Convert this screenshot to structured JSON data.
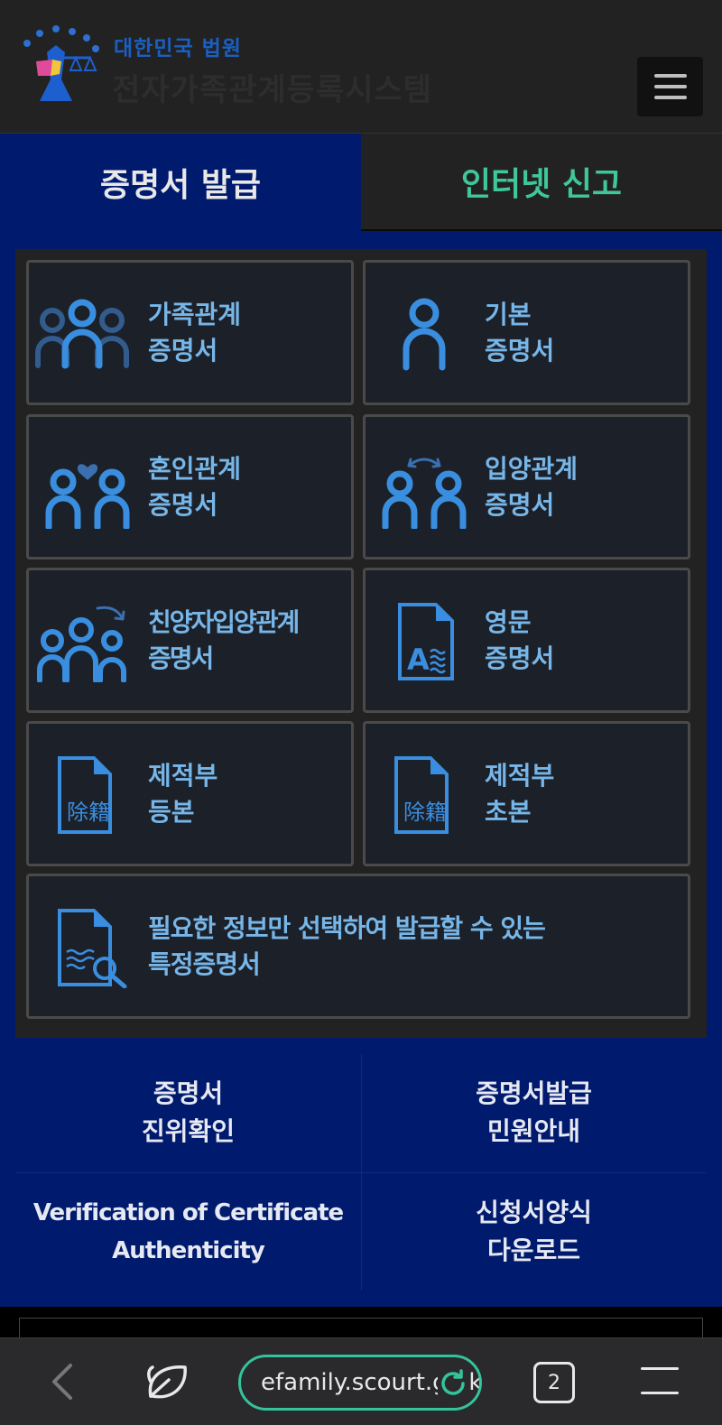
{
  "header": {
    "org": "대한민국 법원",
    "system": "전자가족관계등록시스템"
  },
  "tabs": [
    {
      "label": "증명서 발급",
      "active": true
    },
    {
      "label": "인터넷 신고",
      "active": false
    }
  ],
  "cards": [
    {
      "line1": "가족관계",
      "line2": "증명서",
      "icon": "family-icon"
    },
    {
      "line1": "기본",
      "line2": "증명서",
      "icon": "person-icon"
    },
    {
      "line1": "혼인관계",
      "line2": "증명서",
      "icon": "couple-heart-icon"
    },
    {
      "line1": "입양관계",
      "line2": "증명서",
      "icon": "adoption-icon"
    },
    {
      "line1": "친양자입양관계",
      "line2": "증명서",
      "icon": "family-adoption-icon"
    },
    {
      "line1": "영문",
      "line2": "증명서",
      "icon": "english-document-icon"
    },
    {
      "line1": "제적부",
      "line2": "등본",
      "icon": "removed-register-document-icon"
    },
    {
      "line1": "제적부",
      "line2": "초본",
      "icon": "removed-register-document-icon"
    },
    {
      "line1": "필요한 정보만 선택하여 발급할 수 있는",
      "line2": "특정증명서",
      "icon": "document-search-icon"
    }
  ],
  "icon_text": {
    "english_letter": "A",
    "removed_register": "除籍"
  },
  "links": [
    {
      "line1": "증명서",
      "line2": "진위확인"
    },
    {
      "line1": "증명서발급",
      "line2": "민원안내"
    },
    {
      "line1": "Verification of Certificate",
      "line2": "Authenticity"
    },
    {
      "line1": "신청서양식",
      "line2": "다운로드"
    }
  ],
  "browser": {
    "url": "efamily.scourt.go.kr",
    "tab_count": "2"
  },
  "colors": {
    "navy": "#001a6e",
    "card_text": "#77b6e8",
    "icon_blue": "#3a8ee0",
    "green_accent": "#3fc79a"
  }
}
